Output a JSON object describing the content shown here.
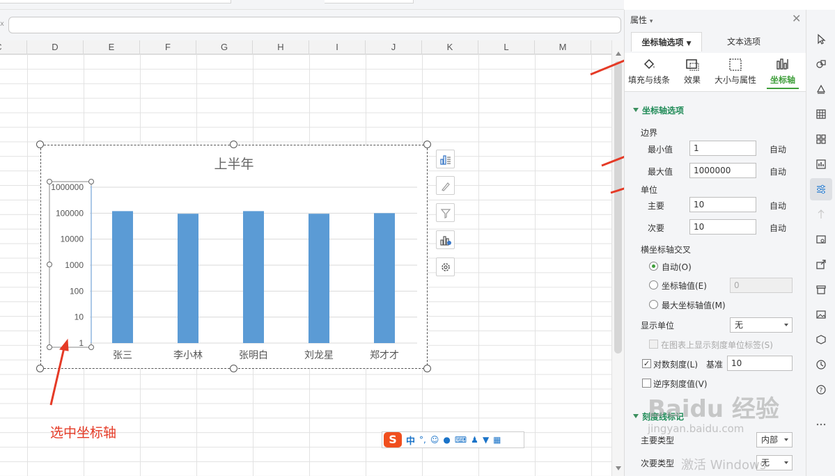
{
  "formula_bar": {
    "fx_mark": "x",
    "value": ""
  },
  "columns": [
    "C",
    "D",
    "E",
    "F",
    "G",
    "H",
    "I",
    "J",
    "K",
    "L",
    "M"
  ],
  "chart": {
    "title": "上半年",
    "side_tools": [
      "chart-elements-icon",
      "chart-style-icon",
      "chart-filter-icon",
      "chart-type-icon",
      "chart-settings-icon"
    ]
  },
  "chart_data": {
    "type": "bar",
    "title": "上半年",
    "categories": [
      "张三",
      "李小林",
      "张明白",
      "刘龙星",
      "郑才才"
    ],
    "values": [
      120000,
      95000,
      120000,
      95000,
      100000
    ],
    "ylabel": "",
    "xlabel": "",
    "y_scale": "log10",
    "ylim": [
      1,
      1000000
    ],
    "yticks": [
      "1",
      "10",
      "100",
      "1000",
      "10000",
      "100000",
      "1000000"
    ],
    "grid": true,
    "bar_color": "#5b9bd5"
  },
  "annotation": {
    "text": "选中坐标轴",
    "color": "#e53a26"
  },
  "ime": {
    "logo": "S",
    "mode": "中",
    "punct": "°,"
  },
  "watermark": {
    "brand": "Baidu 经验",
    "url": "jingyan.baidu.com",
    "os": "激活 Windows"
  },
  "panel": {
    "title": "属性",
    "tabs": {
      "active": "坐标轴选项",
      "inactive": "文本选项"
    },
    "icon_tabs": [
      "填充与线条",
      "效果",
      "大小与属性",
      "坐标轴"
    ],
    "section_title": "坐标轴选项",
    "bounds": {
      "heading": "边界",
      "min_label": "最小值",
      "min_value": "1",
      "min_auto": "自动",
      "max_label": "最大值",
      "max_value": "1000000",
      "max_auto": "自动"
    },
    "units": {
      "heading": "单位",
      "major_label": "主要",
      "major_value": "10",
      "major_auto": "自动",
      "minor_label": "次要",
      "minor_value": "10",
      "minor_auto": "自动"
    },
    "cross": {
      "heading": "横坐标轴交叉",
      "opt_auto": "自动(O)",
      "opt_value": "坐标轴值(E)",
      "opt_value_input": "0",
      "opt_max": "最大坐标轴值(M)"
    },
    "display_unit": {
      "label": "显示单位",
      "value": "无",
      "show_label": "在图表上显示刻度单位标签(S)"
    },
    "log_scale": {
      "label": "对数刻度(L)",
      "base_label": "基准",
      "base_value": "10",
      "checked": true
    },
    "reverse": {
      "label": "逆序刻度值(V)",
      "checked": false
    },
    "tick_section": {
      "title": "刻度线标记"
    },
    "major_type": {
      "label": "主要类型",
      "value": "内部"
    },
    "minor_type": {
      "label": "次要类型",
      "value": "无"
    }
  },
  "accent_green": "#3e9e3a"
}
